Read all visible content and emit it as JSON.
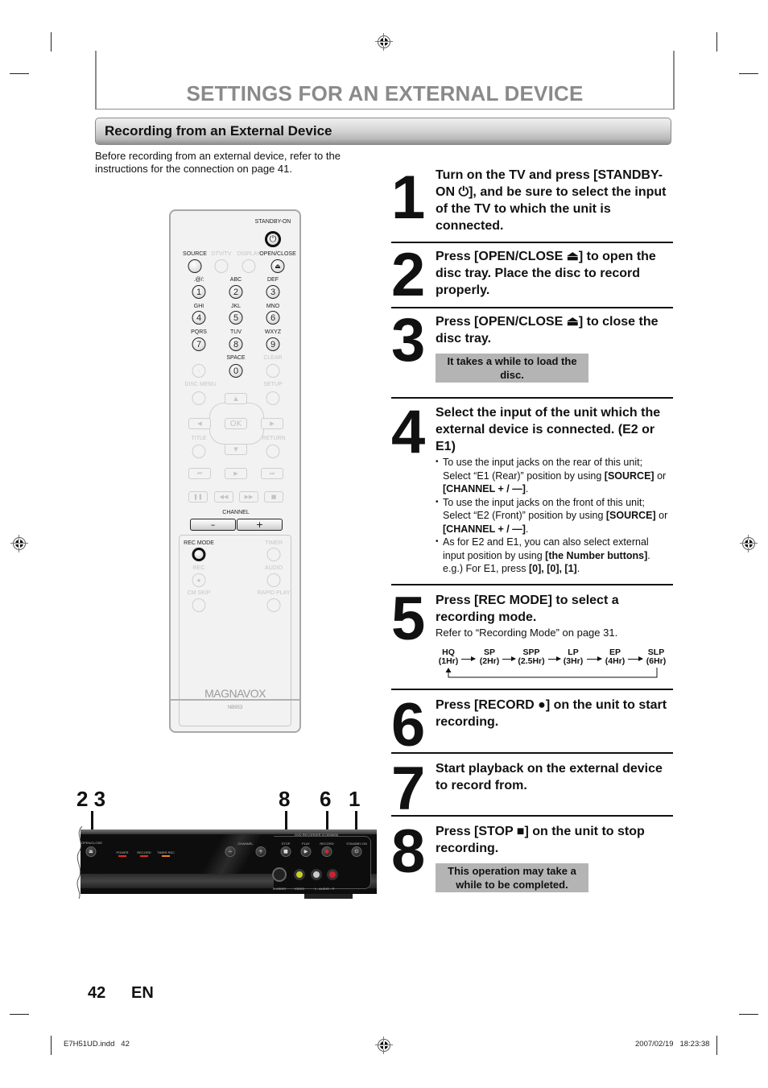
{
  "header": {
    "page_title": "SETTINGS FOR AN EXTERNAL DEVICE",
    "section_title": "Recording from an External Device",
    "intro": "Before recording from an external device, refer to the instructions for the connection on page 41."
  },
  "remote": {
    "labels": {
      "standby_on": "STANDBY-ON",
      "source": "SOURCE",
      "dtv_tv": "DTV/TV",
      "display": "DISPLAY",
      "open_close": "OPEN/CLOSE",
      "k1": ".@/:",
      "k2": "ABC",
      "k3": "DEF",
      "k4": "GHI",
      "k5": "JKL",
      "k6": "MNO",
      "k7": "PQRS",
      "k8": "TUV",
      "k9": "WXYZ",
      "space": "SPACE",
      "clear": "CLEAR",
      "disc_menu": "DISC MENU",
      "setup": "SETUP",
      "title": "TITLE",
      "return": "RETURN",
      "channel": "CHANNEL",
      "rec_mode": "REC MODE",
      "timer": "TIMER",
      "rec": "REC",
      "audio": "AUDIO",
      "cm_skip": "CM SKIP",
      "rapid_play": "RAPID PLAY"
    },
    "digits": [
      "1",
      "2",
      "3",
      "4",
      "5",
      "6",
      "7",
      "8",
      "9",
      "0"
    ],
    "dot": "·",
    "ok": "OK",
    "channel_minus": "–",
    "channel_plus": "+",
    "brand": "MAGNAVOX",
    "model": "NB953"
  },
  "device": {
    "callouts": [
      "2 3",
      "8",
      "6",
      "1"
    ],
    "labels": {
      "open_close": "OPEN/CLOSE",
      "power": "POWER",
      "record_led": "RECORD",
      "timer_rec": "TIMER REC",
      "channel": "CHANNEL",
      "stop": "STOP",
      "play": "PLAY",
      "record": "RECORD",
      "standby_on": "STANDBY-ON",
      "product": "DVD RECORDER ZC350MS8",
      "svideo": "S-VIDEO",
      "video": "VIDEO",
      "audio": "L - AUDIO - R"
    },
    "colors": {
      "led_power": "#e03020",
      "led_record": "#e03020",
      "led_timer": "#f08020",
      "jack_video": "#c8d020",
      "jack_audio_l": "#cccccc",
      "jack_audio_r": "#d02030"
    }
  },
  "steps": [
    {
      "num": "1",
      "text": "Turn on the TV and press [STANDBY-ON ⏻], and be sure to select the input of the TV to which the unit is connected."
    },
    {
      "num": "2",
      "text": "Press [OPEN/CLOSE ⏏] to open the disc tray. Place the disc to record properly."
    },
    {
      "num": "3",
      "text": "Press [OPEN/CLOSE ⏏] to close the disc tray.",
      "note": "It takes a while to load the disc."
    },
    {
      "num": "4",
      "text": "Select the input of the unit which the external device is connected. (E2 or E1)",
      "bullets": [
        {
          "a": "To use the input jacks on the rear of this unit; Select “E1 (Rear)” position by using ",
          "b": "[SOURCE]",
          "c": " or ",
          "d": "[CHANNEL + / —]",
          "e": "."
        },
        {
          "a": "To use the input jacks on the front of this unit; Select “E2 (Front)” position by using ",
          "b": "[SOURCE]",
          "c": " or ",
          "d": "[CHANNEL + / —]",
          "e": "."
        },
        {
          "a": "As for E2 and E1, you can also select external input position by using ",
          "b": "[the Number buttons]",
          "c": ". e.g.) For E1, press ",
          "d": "[0], [0], [1]",
          "e": "."
        }
      ]
    },
    {
      "num": "5",
      "text": "Press [REC MODE] to select a recording mode.",
      "refer": "Refer to “Recording Mode” on page 31.",
      "modes": [
        {
          "name": "HQ",
          "time": "(1Hr)"
        },
        {
          "name": "SP",
          "time": "(2Hr)"
        },
        {
          "name": "SPP",
          "time": "(2.5Hr)"
        },
        {
          "name": "LP",
          "time": "(3Hr)"
        },
        {
          "name": "EP",
          "time": "(4Hr)"
        },
        {
          "name": "SLP",
          "time": "(6Hr)"
        }
      ]
    },
    {
      "num": "6",
      "text": "Press [RECORD ●] on the unit to start recording."
    },
    {
      "num": "7",
      "text": "Start playback on the external device to record from."
    },
    {
      "num": "8",
      "text": "Press [STOP ■] on the unit to stop recording.",
      "note": "This operation may take a while to be completed."
    }
  ],
  "footer": {
    "page_number": "42",
    "language": "EN",
    "slug_file": "E7H51UD.indd   42",
    "slug_date": "2007/02/19   18:23:38"
  }
}
